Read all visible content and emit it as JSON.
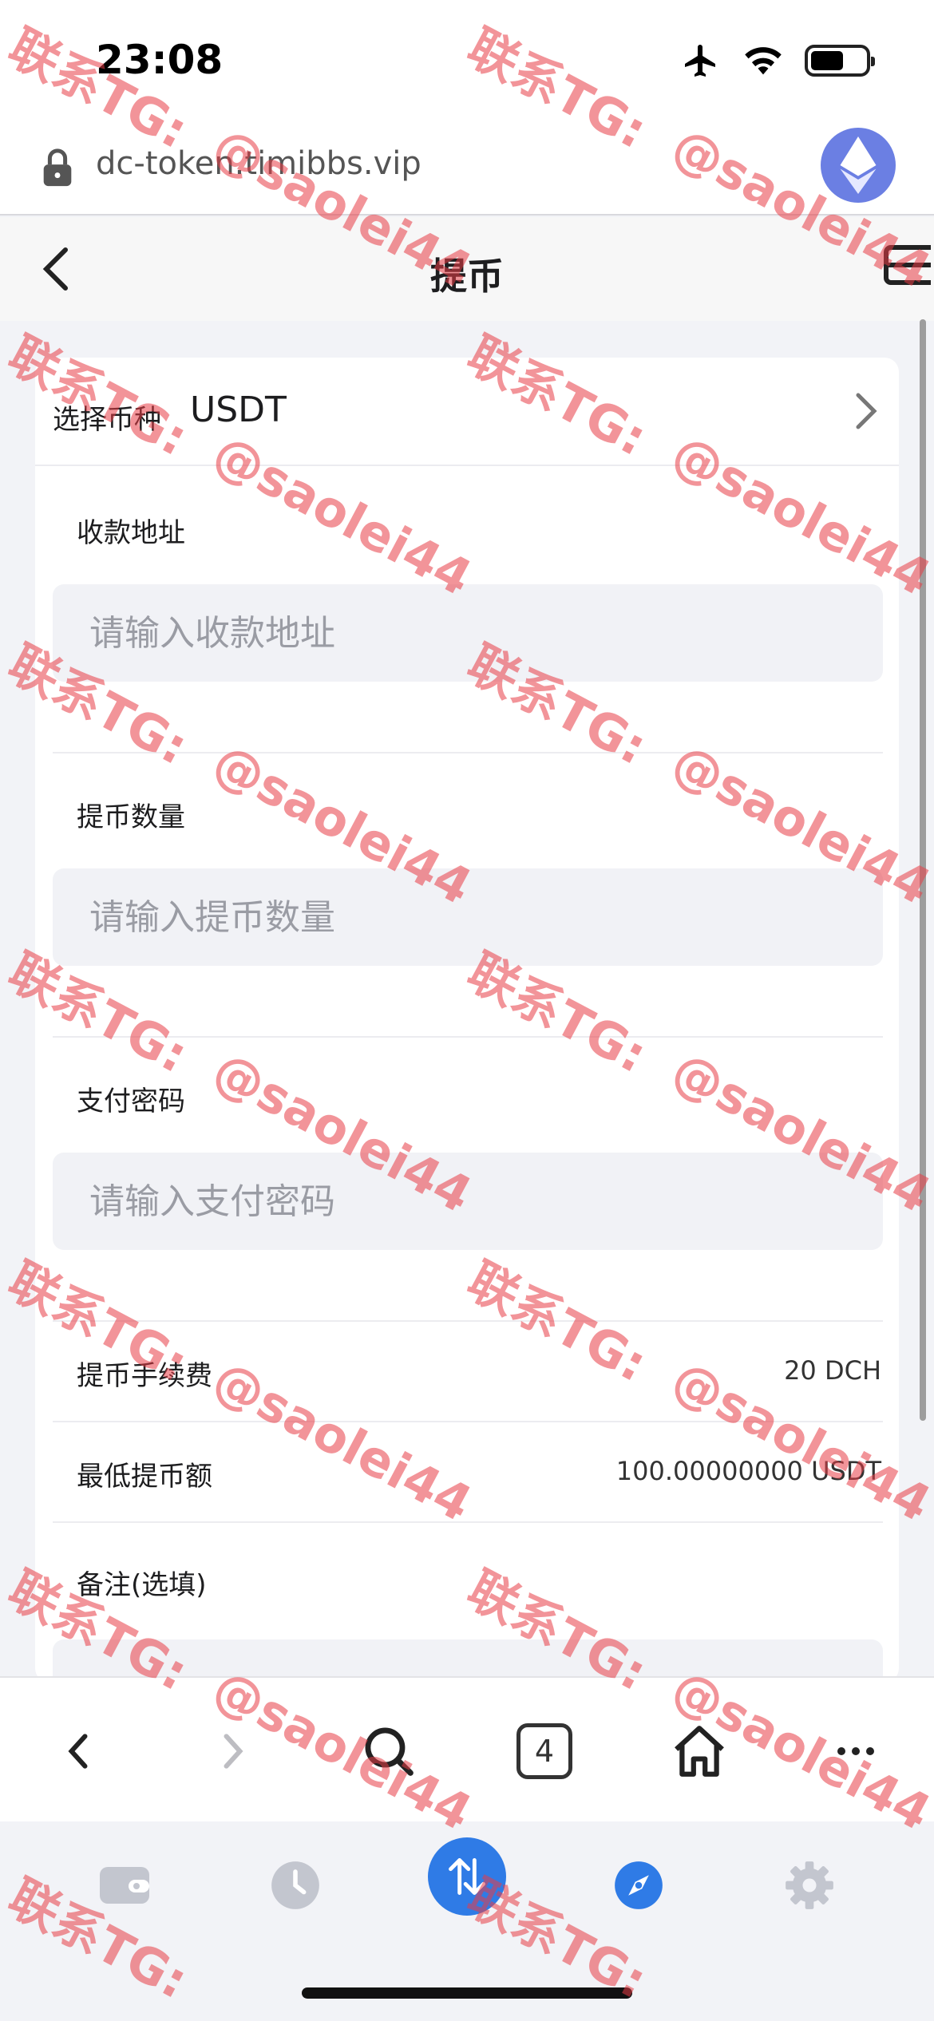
{
  "status_bar": {
    "time": "23:08"
  },
  "browser": {
    "url": "dc-token.timibbs.vip",
    "tab_count": "4"
  },
  "header": {
    "title": "提币"
  },
  "form": {
    "currency_label": "选择币种",
    "currency_value": "USDT",
    "address_label": "收款地址",
    "address_placeholder": "请输入收款地址",
    "amount_label": "提币数量",
    "amount_placeholder": "请输入提币数量",
    "password_label": "支付密码",
    "password_placeholder": "请输入支付密码",
    "fee_label": "提币手续费",
    "fee_value": "20 DCH",
    "min_label": "最低提币额",
    "min_value": "100.00000000 USDT",
    "remark_label": "备注(选填)"
  },
  "watermark": {
    "line1": "联系TG:",
    "line2": "@saolei44"
  },
  "colors": {
    "accent": "#2f7be6",
    "eth": "#6b7fe3",
    "watermark": "#e83c46"
  }
}
